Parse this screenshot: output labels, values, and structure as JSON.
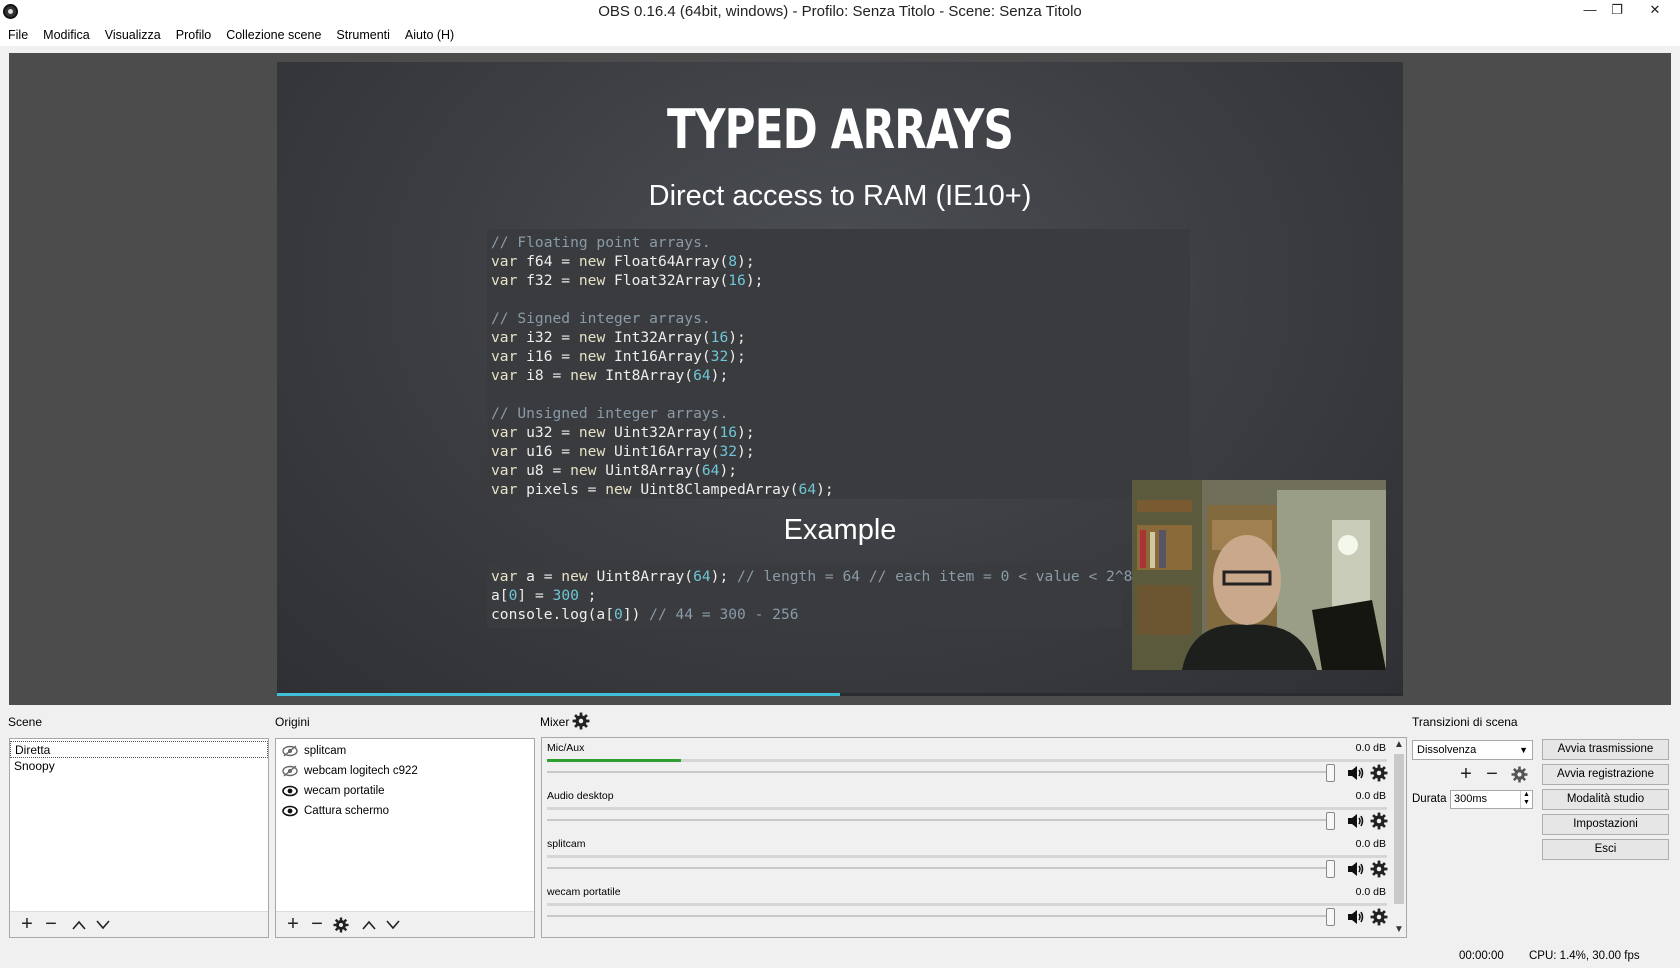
{
  "window": {
    "title": "OBS 0.16.4 (64bit, windows) - Profilo: Senza Titolo - Scene: Senza Titolo",
    "minimize": "—",
    "restore": "❐",
    "close": "✕"
  },
  "menu": [
    "File",
    "Modifica",
    "Visualizza",
    "Profilo",
    "Collezione scene",
    "Strumenti",
    "Aiuto (H)"
  ],
  "preview": {
    "slide_title": "TYPED ARRAYS",
    "slide_subtitle": "Direct access to RAM (IE10+)",
    "example_title": "Example",
    "slide_progress_fraction": 0.5
  },
  "docks": {
    "scenes_label": "Scene",
    "sources_label": "Origini",
    "mixer_label": "Mixer",
    "transitions_label": "Transizioni di scena"
  },
  "scenes": [
    "Diretta",
    "Snoopy"
  ],
  "sources": [
    {
      "name": "splitcam",
      "visible": false
    },
    {
      "name": "webcam logitech c922",
      "visible": false
    },
    {
      "name": "wecam portatile",
      "visible": true
    },
    {
      "name": "Cattura schermo",
      "visible": true
    }
  ],
  "mixer": [
    {
      "name": "Mic/Aux",
      "db": "0.0 dB",
      "level": 0.16
    },
    {
      "name": "Audio desktop",
      "db": "0.0 dB",
      "level": 0
    },
    {
      "name": "splitcam",
      "db": "0.0 dB",
      "level": 0
    },
    {
      "name": "wecam portatile",
      "db": "0.0 dB",
      "level": 0
    }
  ],
  "transitions": {
    "selected": "Dissolvenza",
    "duration_label": "Durata",
    "duration_value": "300ms"
  },
  "controls": {
    "start_streaming": "Avvia trasmissione",
    "start_recording": "Avvia registrazione",
    "studio_mode": "Modalità studio",
    "settings": "Impostazioni",
    "exit": "Esci"
  },
  "status": {
    "time": "00:00:00",
    "cpu": "CPU: 1.4%, 30.00 fps"
  },
  "colors": {
    "accent": "#3fc0d8",
    "meter_green": "#2fa02f"
  }
}
